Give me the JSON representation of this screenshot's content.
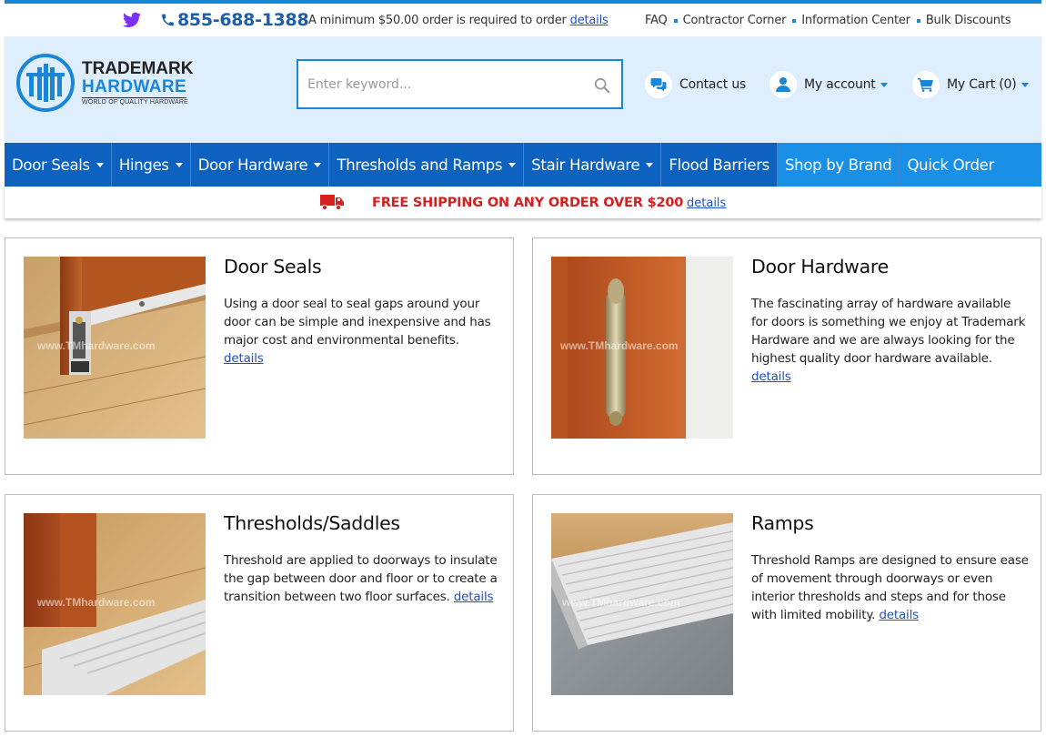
{
  "utility": {
    "phone": "855-688-1388",
    "minimum_text": "A minimum $50.00 order is required to order",
    "minimum_link": "details",
    "links": [
      "FAQ",
      "Contractor Corner",
      "Information Center",
      "Bulk Discounts"
    ]
  },
  "brand": {
    "line1": "TRADEMARK",
    "line2": "HARDWARE",
    "tagline": "WORLD OF QUALITY HARDWARE"
  },
  "search": {
    "placeholder": "Enter keyword..."
  },
  "header": {
    "contact": "Contact us",
    "account": "My account",
    "cart": "My Cart (0)"
  },
  "nav": [
    {
      "label": "Door Seals",
      "dropdown": true
    },
    {
      "label": "Hinges",
      "dropdown": true
    },
    {
      "label": "Door Hardware",
      "dropdown": true
    },
    {
      "label": "Thresholds and Ramps",
      "dropdown": true
    },
    {
      "label": "Stair Hardware",
      "dropdown": true
    },
    {
      "label": "Flood Barriers",
      "dropdown": false
    },
    {
      "label": "Shop by Brand",
      "dropdown": false
    },
    {
      "label": "Quick Order",
      "dropdown": false
    }
  ],
  "shipping": {
    "text": "FREE SHIPPING ON ANY ORDER OVER $200",
    "link": "details"
  },
  "watermark": "www.TMhardware.com",
  "cards": [
    {
      "title": "Door Seals",
      "body": "Using a door seal to seal gaps around your door can be simple and inexpensive and has major cost and environmental benefits.",
      "link": "details"
    },
    {
      "title": "Door Hardware",
      "body": "The fascinating array of hardware available for doors is something we enjoy at Trademark Hardware and we are always looking for the highest quality door hardware available.",
      "link": "details"
    },
    {
      "title": "Thresholds/Saddles",
      "body": "Threshold are applied to doorways to insulate the gap between door and floor or to create a transition between two floor surfaces.",
      "link": "details"
    },
    {
      "title": "Ramps",
      "body": "Threshold Ramps are designed to ensure ease of movement through doorways or even interior thresholds and steps and for those with limited mobility.",
      "link": "details"
    }
  ],
  "colors": {
    "accent": "#1a86d8",
    "nav": "#0d62c0",
    "nav_light": "#1a8fe6",
    "header_bg": "#dfeefc",
    "promo_red": "#d61f1f",
    "twitter": "#7b2ff7"
  }
}
